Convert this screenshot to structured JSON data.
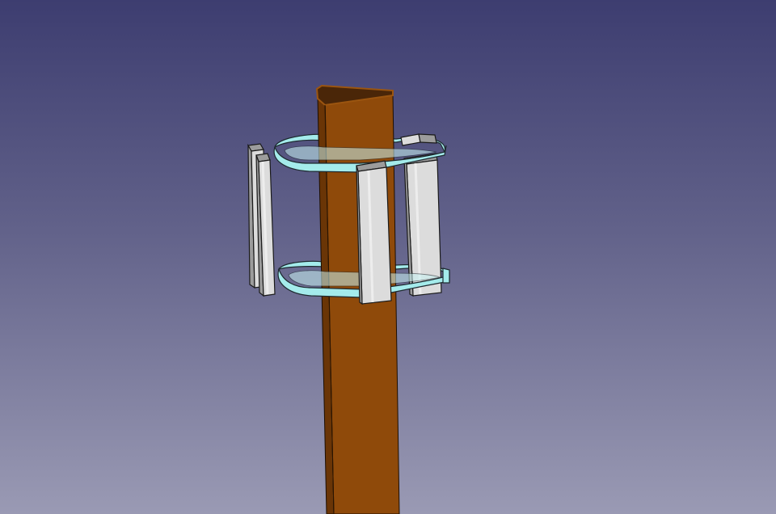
{
  "viewport": {
    "background": {
      "top": "#3d3d70",
      "middle": "#62628a",
      "bottom": "#9a9ab4"
    }
  },
  "model": {
    "pole": {
      "front": "#8f4a0a",
      "side": "#6a3506",
      "top": "#4a2608",
      "top_edge": "#9b5510"
    },
    "brackets": {
      "fill": "#a4ebeb",
      "stroke": "#1e2a30",
      "inner": "#c8f3f3"
    },
    "antennas": {
      "face": "#dcdcdc",
      "side": "#9c9c9c",
      "highlight": "#f2f2f2",
      "edge": "#1a1a1a",
      "count": 4
    }
  }
}
